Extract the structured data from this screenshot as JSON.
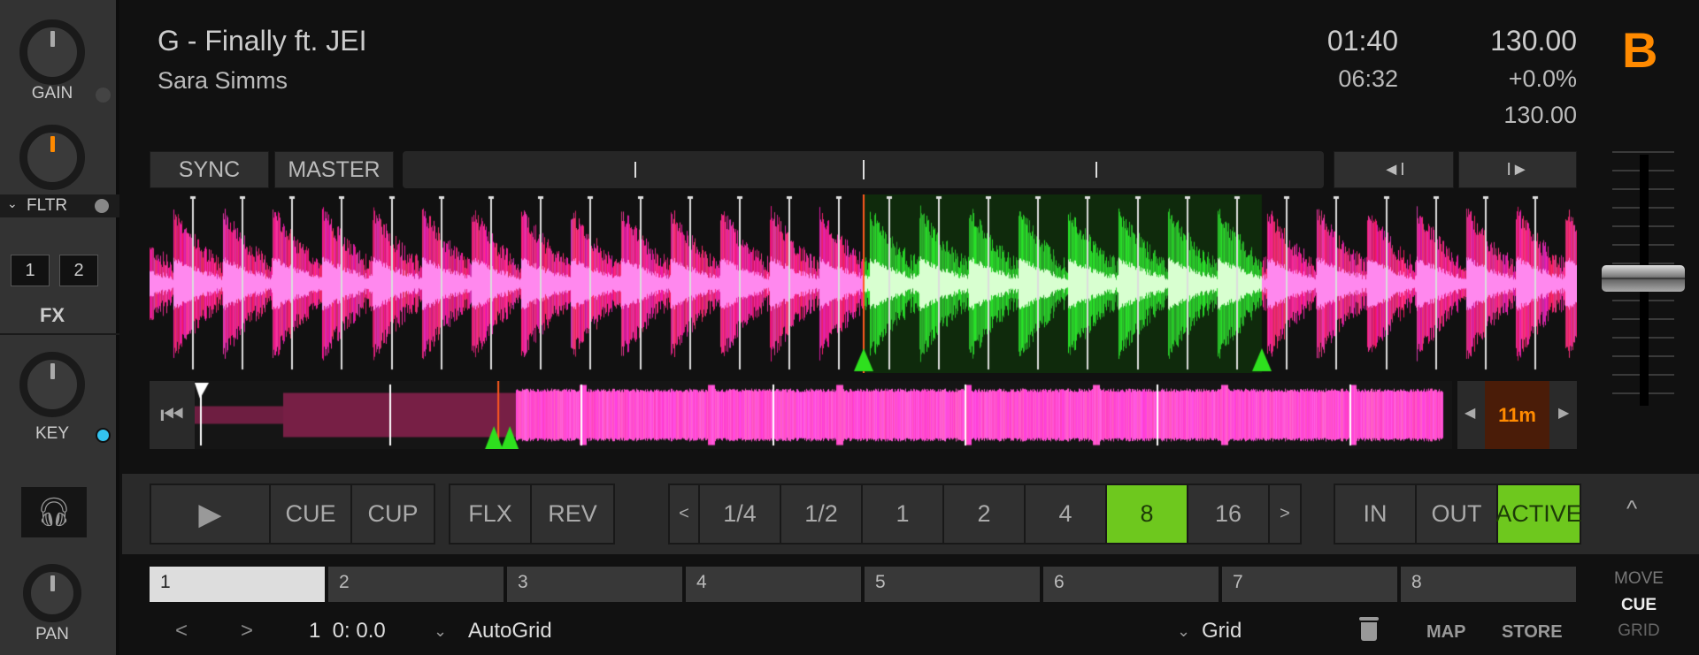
{
  "mixer": {
    "gain_label": "GAIN",
    "filter_label": "FLTR",
    "fx_buttons": [
      "1",
      "2"
    ],
    "fx_label": "FX",
    "key_label": "KEY",
    "pan_label": "PAN",
    "key_led_color": "#33c4f0",
    "filter_indicator_color": "#ff8a00"
  },
  "track": {
    "title": "G - Finally ft. JEI",
    "artist": "Sara Simms",
    "elapsed": "01:40",
    "remaining": "06:32",
    "bpm": "130.00",
    "tempo_offset": "+0.0%",
    "original_bpm": "130.00",
    "deck_letter": "B",
    "deck_color": "#ff8a00"
  },
  "topbar": {
    "sync": "SYNC",
    "master": "MASTER",
    "beatjump_back": "◄I",
    "beatjump_fwd": "I►"
  },
  "overview": {
    "zoom_label": "11m",
    "playhead_position": 0.245
  },
  "transport": {
    "play": "▶",
    "cue": "CUE",
    "cup": "CUP",
    "flx": "FLX",
    "rev": "REV"
  },
  "loop": {
    "prev": "<",
    "sizes": [
      "1/4",
      "1/2",
      "1",
      "2",
      "4",
      "8",
      "16"
    ],
    "selected": "8",
    "next": ">",
    "in": "IN",
    "out": "OUT",
    "active": "ACTIVE",
    "accent": "#6ec81e",
    "collapse": "^"
  },
  "cues": {
    "slots": [
      "1",
      "2",
      "3",
      "4",
      "5",
      "6",
      "7",
      "8"
    ],
    "selected": "1"
  },
  "bottom": {
    "prev": "<",
    "next": ">",
    "position": "1  0: 0.0",
    "grid_mode": "AutoGrid",
    "grid_type": "Grid",
    "map": "MAP",
    "store": "STORE",
    "mode_move": "MOVE",
    "mode_cue": "CUE",
    "mode_grid": "GRID"
  },
  "tempo_fader": {
    "value": 0.5
  }
}
